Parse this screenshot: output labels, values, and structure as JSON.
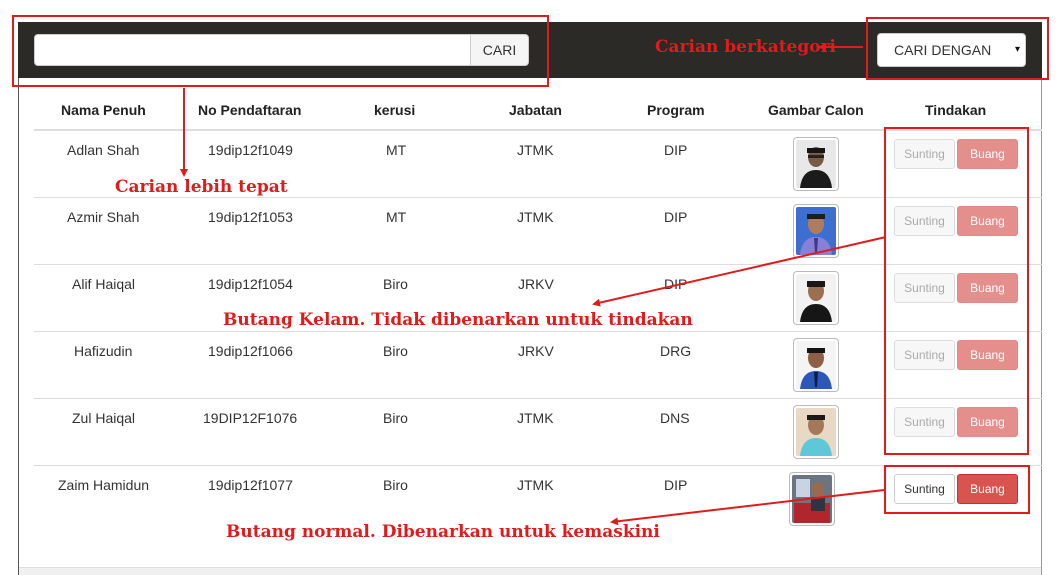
{
  "search": {
    "button_label": "CARI",
    "value": ""
  },
  "filter": {
    "selected": "CARI DENGAN",
    "caret": "▾"
  },
  "table": {
    "headers": [
      "Nama Penuh",
      "No Pendaftaran",
      "kerusi",
      "Jabatan",
      "Program",
      "Gambar Calon",
      "Tindakan"
    ],
    "rows": [
      {
        "name": "Adlan Shah",
        "reg": "19dip12f1049",
        "seat": "MT",
        "dept": "JTMK",
        "program": "DIP",
        "edit": "Sunting",
        "delete": "Buang",
        "enabled": false
      },
      {
        "name": "Azmir Shah",
        "reg": "19dip12f1053",
        "seat": "MT",
        "dept": "JTMK",
        "program": "DIP",
        "edit": "Sunting",
        "delete": "Buang",
        "enabled": false
      },
      {
        "name": "Alif Haiqal",
        "reg": "19dip12f1054",
        "seat": "Biro",
        "dept": "JRKV",
        "program": "DIP",
        "edit": "Sunting",
        "delete": "Buang",
        "enabled": false
      },
      {
        "name": "Hafizudin",
        "reg": "19dip12f1066",
        "seat": "Biro",
        "dept": "JRKV",
        "program": "DRG",
        "edit": "Sunting",
        "delete": "Buang",
        "enabled": false
      },
      {
        "name": "Zul Haiqal",
        "reg": "19DIP12F1076",
        "seat": "Biro",
        "dept": "JTMK",
        "program": "DNS",
        "edit": "Sunting",
        "delete": "Buang",
        "enabled": false
      },
      {
        "name": "Zaim Hamidun",
        "reg": "19dip12f1077",
        "seat": "Biro",
        "dept": "JTMK",
        "program": "DIP",
        "edit": "Sunting",
        "delete": "Buang",
        "enabled": true
      }
    ]
  },
  "annotations": {
    "category_search": "Carian berkategori",
    "precise_search": "Carian lebih tepat",
    "disabled_buttons": "Butang Kelam. Tidak dibenarkan untuk tindakan",
    "normal_buttons": "Butang normal. Dibenarkan untuk kemaskini"
  },
  "colors": {
    "topbar": "#2b2a26",
    "annotation_red": "#e01b1b",
    "delete_button": "#d9534f",
    "delete_button_disabled": "#e58f8d"
  }
}
